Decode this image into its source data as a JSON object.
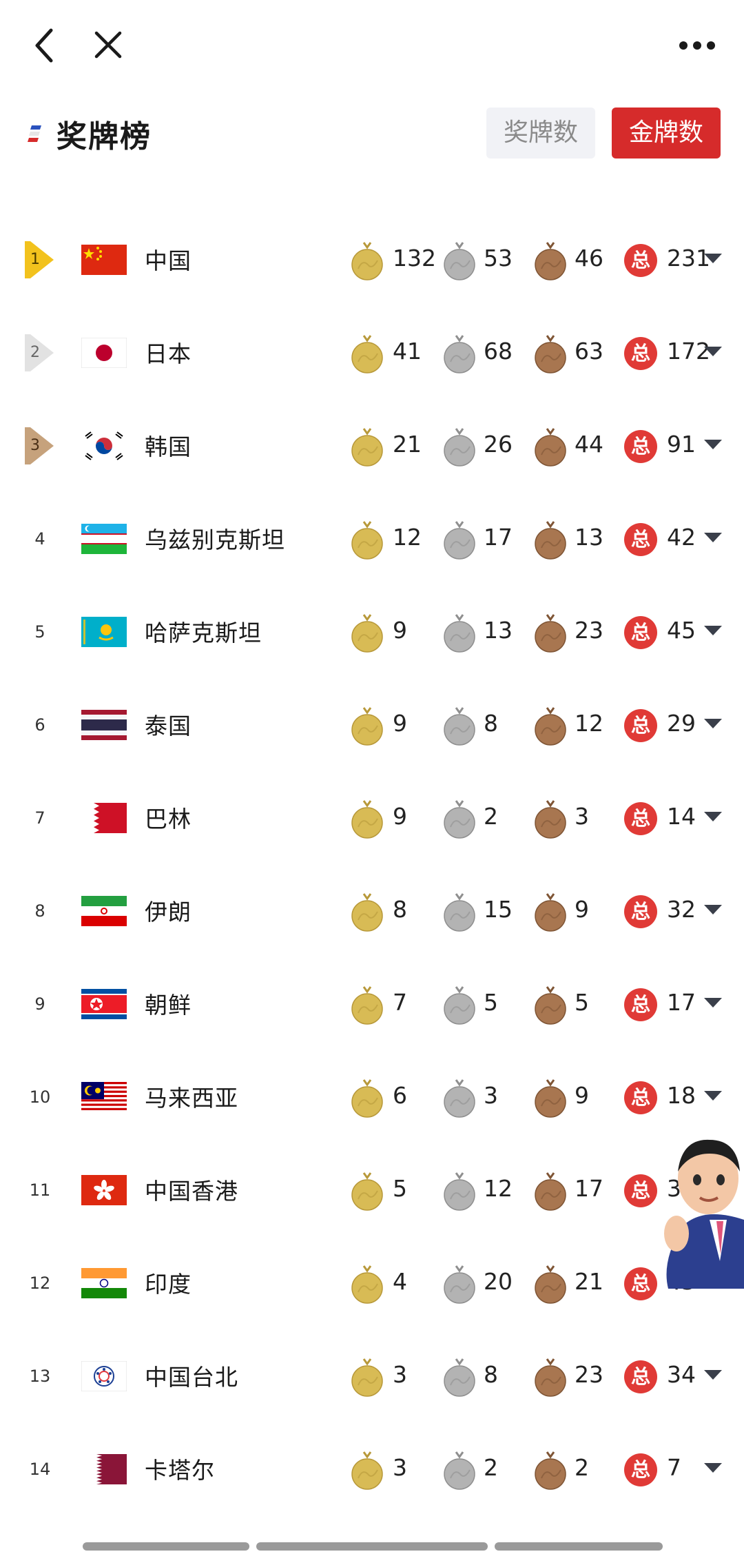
{
  "nav": {
    "back_icon": "chevron-left-icon",
    "close_icon": "close-icon",
    "more_icon": "more-dots-icon"
  },
  "header": {
    "title": "奖牌榜",
    "tabs": [
      {
        "label": "奖牌数",
        "active": false
      },
      {
        "label": "金牌数",
        "active": true
      }
    ]
  },
  "total_label": "总",
  "colors": {
    "accent": "#d62b2b",
    "total_badge": "#e03a36",
    "gold_medal": "#d8bb55",
    "silver_medal": "#b3b3b3",
    "bronze_medal": "#a87650",
    "rank_gold": "#f2c21d",
    "rank_silver": "#e2e2e2",
    "rank_bronze": "#c6a27c"
  },
  "rows": [
    {
      "rank": "1",
      "country": "中国",
      "flag": "china-flag",
      "gold": "132",
      "silver": "53",
      "bronze": "46",
      "total": "231"
    },
    {
      "rank": "2",
      "country": "日本",
      "flag": "japan-flag",
      "gold": "41",
      "silver": "68",
      "bronze": "63",
      "total": "172"
    },
    {
      "rank": "3",
      "country": "韩国",
      "flag": "south-korea-flag",
      "gold": "21",
      "silver": "26",
      "bronze": "44",
      "total": "91"
    },
    {
      "rank": "4",
      "country": "乌兹别克斯坦",
      "flag": "uzbekistan-flag",
      "gold": "12",
      "silver": "17",
      "bronze": "13",
      "total": "42"
    },
    {
      "rank": "5",
      "country": "哈萨克斯坦",
      "flag": "kazakhstan-flag",
      "gold": "9",
      "silver": "13",
      "bronze": "23",
      "total": "45"
    },
    {
      "rank": "6",
      "country": "泰国",
      "flag": "thailand-flag",
      "gold": "9",
      "silver": "8",
      "bronze": "12",
      "total": "29"
    },
    {
      "rank": "7",
      "country": "巴林",
      "flag": "bahrain-flag",
      "gold": "9",
      "silver": "2",
      "bronze": "3",
      "total": "14"
    },
    {
      "rank": "8",
      "country": "伊朗",
      "flag": "iran-flag",
      "gold": "8",
      "silver": "15",
      "bronze": "9",
      "total": "32"
    },
    {
      "rank": "9",
      "country": "朝鲜",
      "flag": "north-korea-flag",
      "gold": "7",
      "silver": "5",
      "bronze": "5",
      "total": "17"
    },
    {
      "rank": "10",
      "country": "马来西亚",
      "flag": "malaysia-flag",
      "gold": "6",
      "silver": "3",
      "bronze": "9",
      "total": "18"
    },
    {
      "rank": "11",
      "country": "中国香港",
      "flag": "hong-kong-flag",
      "gold": "5",
      "silver": "12",
      "bronze": "17",
      "total": "3"
    },
    {
      "rank": "12",
      "country": "印度",
      "flag": "india-flag",
      "gold": "4",
      "silver": "20",
      "bronze": "21",
      "total": "45"
    },
    {
      "rank": "13",
      "country": "中国台北",
      "flag": "chinese-taipei-flag",
      "gold": "3",
      "silver": "8",
      "bronze": "23",
      "total": "34"
    },
    {
      "rank": "14",
      "country": "卡塔尔",
      "flag": "qatar-flag",
      "gold": "3",
      "silver": "2",
      "bronze": "2",
      "total": "7"
    }
  ]
}
